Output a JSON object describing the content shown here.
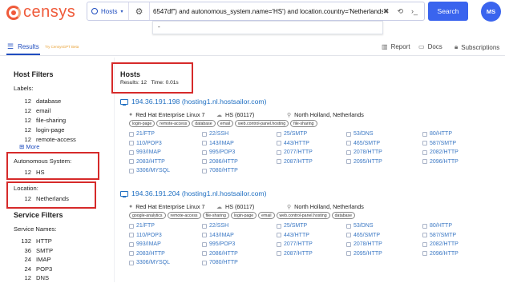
{
  "header": {
    "logo_text": "censys",
    "search_scope": "Hosts",
    "query": "6547df\") and autonomous_system.name='HS') and location.country='Netherlands'",
    "suggestion": "-",
    "search_button": "Search",
    "avatar_initials": "MS"
  },
  "toolbar": {
    "results_tab": "Results",
    "gpt_link": "Try CensysGPT Beta",
    "report": "Report",
    "docs": "Docs",
    "subscriptions": "Subscriptions"
  },
  "sidebar": {
    "title": "Host Filters",
    "labels_heading": "Labels:",
    "labels": [
      {
        "count": "12",
        "name": "database"
      },
      {
        "count": "12",
        "name": "email"
      },
      {
        "count": "12",
        "name": "file-sharing"
      },
      {
        "count": "12",
        "name": "login-page"
      },
      {
        "count": "12",
        "name": "remote-access"
      }
    ],
    "more": "More",
    "as_heading": "Autonomous System:",
    "as_items": [
      {
        "count": "12",
        "name": "HS"
      }
    ],
    "location_heading": "Location:",
    "location_items": [
      {
        "count": "12",
        "name": "Netherlands"
      }
    ],
    "service_title": "Service Filters",
    "service_heading": "Service Names:",
    "services": [
      {
        "count": "132",
        "name": "HTTP"
      },
      {
        "count": "36",
        "name": "SMTP"
      },
      {
        "count": "24",
        "name": "IMAP"
      },
      {
        "count": "24",
        "name": "POP3"
      },
      {
        "count": "12",
        "name": "DNS"
      }
    ]
  },
  "main": {
    "title": "Hosts",
    "results_label": "Results: 12",
    "time_label": "Time: 0.01s",
    "hosts": [
      {
        "ip": "194.36.191.198",
        "hostname": "(hosting1.nl.hostsailor.com)",
        "os": "Red Hat Enterprise Linux 7",
        "asn": "HS (60117)",
        "location": "North Holland, Netherlands",
        "tags": [
          "login-page",
          "remote-access",
          "database",
          "email",
          "web.control-panel.hosting",
          "file-sharing"
        ],
        "services": [
          [
            "21/FTP",
            "22/SSH",
            "25/SMTP",
            "53/DNS",
            "80/HTTP"
          ],
          [
            "110/POP3",
            "143/IMAP",
            "443/HTTP",
            "465/SMTP",
            "587/SMTP"
          ],
          [
            "993/IMAP",
            "995/POP3",
            "2077/HTTP",
            "2078/HTTP",
            "2082/HTTP"
          ],
          [
            "2083/HTTP",
            "2086/HTTP",
            "2087/HTTP",
            "2095/HTTP",
            "2096/HTTP"
          ],
          [
            "3306/MYSQL",
            "7080/HTTP"
          ]
        ]
      },
      {
        "ip": "194.36.191.204",
        "hostname": "(hosting1.nl.hostsailor.com)",
        "os": "Red Hat Enterprise Linux 7",
        "asn": "HS (60117)",
        "location": "North Holland, Netherlands",
        "tags": [
          "google-analytics",
          "remote-access",
          "file-sharing",
          "login-page",
          "email",
          "web.control-panel.hosting",
          "database"
        ],
        "services": [
          [
            "21/FTP",
            "22/SSH",
            "25/SMTP",
            "53/DNS",
            "80/HTTP"
          ],
          [
            "110/POP3",
            "143/IMAP",
            "443/HTTP",
            "465/SMTP",
            "587/SMTP"
          ],
          [
            "993/IMAP",
            "995/POP3",
            "2077/HTTP",
            "2078/HTTP",
            "2082/HTTP"
          ],
          [
            "2083/HTTP",
            "2086/HTTP",
            "2087/HTTP",
            "2095/HTTP",
            "2096/HTTP"
          ],
          [
            "3306/MYSQL",
            "7080/HTTP"
          ]
        ]
      }
    ]
  },
  "colors": {
    "accent": "#3a64ee",
    "link": "#1f6fc2",
    "highlight": "#d62a2a",
    "brand": "#ef5a3a"
  }
}
